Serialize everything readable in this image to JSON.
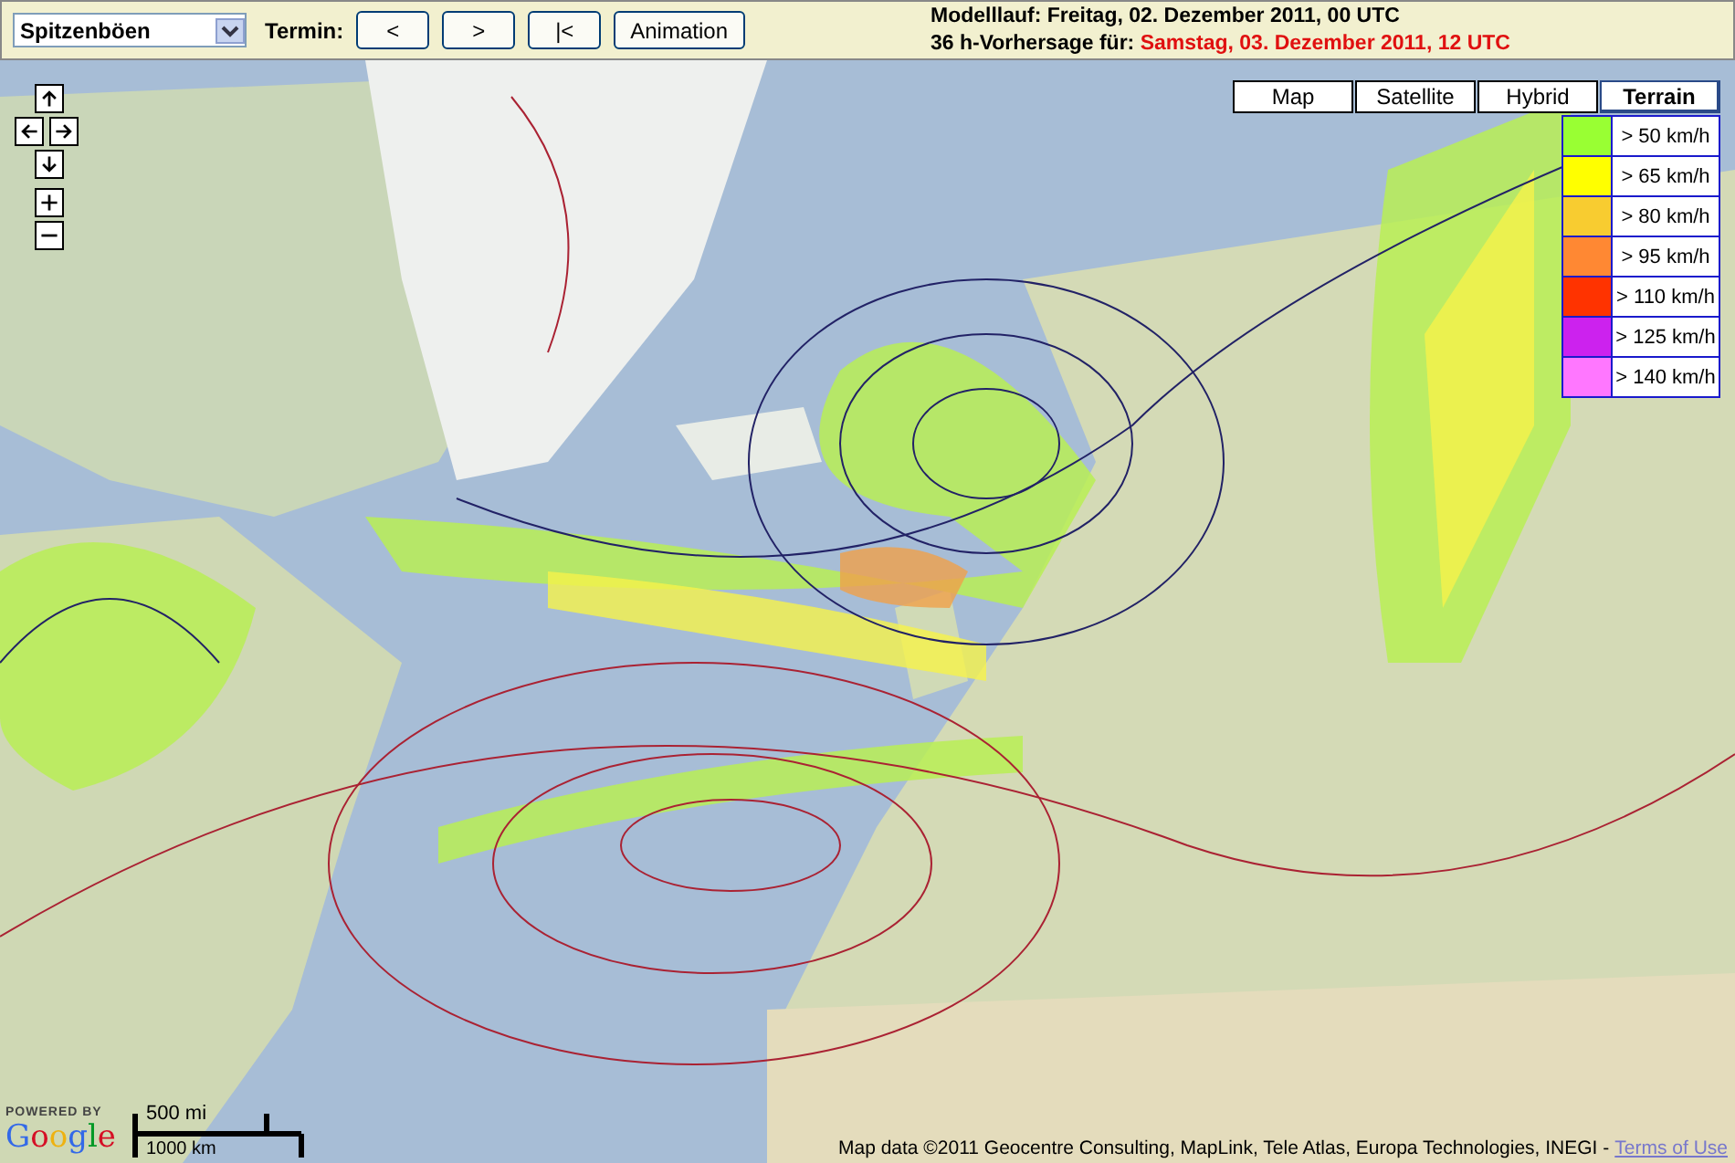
{
  "toolbar": {
    "product_select": {
      "value": "Spitzenböen"
    },
    "termin_label": "Termin:",
    "buttons": [
      {
        "label": "<"
      },
      {
        "label": ">"
      },
      {
        "label": "|<"
      },
      {
        "label": "Animation"
      }
    ],
    "model_run": "Modelllauf: Freitag, 02. Dezember 2011, 00 UTC",
    "forecast": {
      "prefix": "36 h-Vorhersage für:",
      "date": "Samstag, 03. Dezember 2011, 12 UTC"
    }
  },
  "map_types": [
    {
      "label": "Map",
      "selected": false
    },
    {
      "label": "Satellite",
      "selected": false
    },
    {
      "label": "Hybrid",
      "selected": false
    },
    {
      "label": "Terrain",
      "selected": true
    }
  ],
  "legend": [
    {
      "label": "> 50 km/h",
      "color": "#99ff33"
    },
    {
      "label": "> 65 km/h",
      "color": "#ffff00"
    },
    {
      "label": "> 80 km/h",
      "color": "#f8cc30"
    },
    {
      "label": "> 95 km/h",
      "color": "#ff8833"
    },
    {
      "label": "> 110 km/h",
      "color": "#ff3300"
    },
    {
      "label": "> 125 km/h",
      "color": "#cc22ee"
    },
    {
      "label": "> 140 km/h",
      "color": "#ff77ff"
    }
  ],
  "nav_controls": [
    {
      "kind": "up"
    },
    {
      "kind": "left"
    },
    {
      "kind": "right"
    },
    {
      "kind": "down"
    },
    {
      "kind": "zoom-in"
    },
    {
      "kind": "zoom-out"
    }
  ],
  "logo": {
    "powered_by": "POWERED BY",
    "name": "Google"
  },
  "scale": {
    "imperial": "500 mi",
    "metric": "1000 km"
  },
  "attribution": {
    "text": "Map data ©2011 Geocentre Consulting, MapLink, Tele Atlas, Europa Technologies, INEGI -",
    "link": "Terms of Use"
  }
}
